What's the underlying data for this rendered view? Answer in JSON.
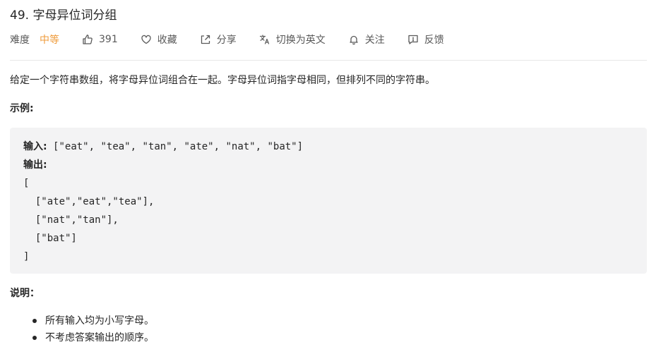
{
  "problem": {
    "title": "49. 字母异位词分组",
    "difficulty_label": "难度",
    "difficulty_value": "中等",
    "likes": "391",
    "actions": {
      "favorite": "收藏",
      "share": "分享",
      "switch_lang": "切换为英文",
      "follow": "关注",
      "feedback": "反馈"
    },
    "description": "给定一个字符串数组，将字母异位词组合在一起。字母异位词指字母相同，但排列不同的字符串。",
    "example_heading": "示例:",
    "example": {
      "input_label": "输入:",
      "input_value": " [\"eat\", \"tea\", \"tan\", \"ate\", \"nat\", \"bat\"]",
      "output_label": "输出:",
      "output_lines": [
        "[",
        "  [\"ate\",\"eat\",\"tea\"],",
        "  [\"nat\",\"tan\"],",
        "  [\"bat\"]",
        "]"
      ]
    },
    "notes_heading": "说明：",
    "notes": [
      "所有输入均为小写字母。",
      "不考虑答案输出的顺序。"
    ]
  },
  "colors": {
    "difficulty_medium": "#ef9b3b",
    "text": "#262626",
    "muted": "#595959",
    "code_bg": "#f3f3f4"
  }
}
